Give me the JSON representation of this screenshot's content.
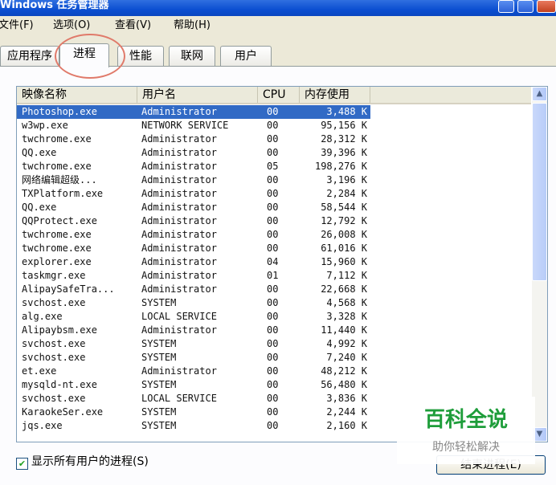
{
  "window": {
    "title": "Windows 任务管理器"
  },
  "menu": [
    "文件(F)",
    "选项(O)",
    "查看(V)",
    "帮助(H)"
  ],
  "tabs": [
    "应用程序",
    "进程",
    "性能",
    "联网",
    "用户"
  ],
  "active_tab": "进程",
  "columns": [
    "映像名称",
    "用户名",
    "CPU",
    "内存使用"
  ],
  "processes": [
    {
      "name": "Photoshop.exe",
      "user": "Administrator",
      "cpu": "00",
      "mem": "3,488 K"
    },
    {
      "name": "w3wp.exe",
      "user": "NETWORK SERVICE",
      "cpu": "00",
      "mem": "95,156 K"
    },
    {
      "name": "twchrome.exe",
      "user": "Administrator",
      "cpu": "00",
      "mem": "28,312 K"
    },
    {
      "name": "QQ.exe",
      "user": "Administrator",
      "cpu": "00",
      "mem": "39,396 K"
    },
    {
      "name": "twchrome.exe",
      "user": "Administrator",
      "cpu": "05",
      "mem": "198,276 K"
    },
    {
      "name": "网络编辑超级...",
      "user": "Administrator",
      "cpu": "00",
      "mem": "3,196 K"
    },
    {
      "name": "TXPlatform.exe",
      "user": "Administrator",
      "cpu": "00",
      "mem": "2,284 K"
    },
    {
      "name": "QQ.exe",
      "user": "Administrator",
      "cpu": "00",
      "mem": "58,544 K"
    },
    {
      "name": "QQProtect.exe",
      "user": "Administrator",
      "cpu": "00",
      "mem": "12,792 K"
    },
    {
      "name": "twchrome.exe",
      "user": "Administrator",
      "cpu": "00",
      "mem": "26,008 K"
    },
    {
      "name": "twchrome.exe",
      "user": "Administrator",
      "cpu": "00",
      "mem": "61,016 K"
    },
    {
      "name": "explorer.exe",
      "user": "Administrator",
      "cpu": "04",
      "mem": "15,960 K"
    },
    {
      "name": "taskmgr.exe",
      "user": "Administrator",
      "cpu": "01",
      "mem": "7,112 K"
    },
    {
      "name": "AlipaySafeTra...",
      "user": "Administrator",
      "cpu": "00",
      "mem": "22,668 K"
    },
    {
      "name": "svchost.exe",
      "user": "SYSTEM",
      "cpu": "00",
      "mem": "4,568 K"
    },
    {
      "name": "alg.exe",
      "user": "LOCAL SERVICE",
      "cpu": "00",
      "mem": "3,328 K"
    },
    {
      "name": "Alipaybsm.exe",
      "user": "Administrator",
      "cpu": "00",
      "mem": "11,440 K"
    },
    {
      "name": "svchost.exe",
      "user": "SYSTEM",
      "cpu": "00",
      "mem": "4,992 K"
    },
    {
      "name": "svchost.exe",
      "user": "SYSTEM",
      "cpu": "00",
      "mem": "7,240 K"
    },
    {
      "name": "et.exe",
      "user": "Administrator",
      "cpu": "00",
      "mem": "48,212 K"
    },
    {
      "name": "mysqld-nt.exe",
      "user": "SYSTEM",
      "cpu": "00",
      "mem": "56,480 K"
    },
    {
      "name": "svchost.exe",
      "user": "LOCAL SERVICE",
      "cpu": "00",
      "mem": "3,836 K"
    },
    {
      "name": "KaraokeSer.exe",
      "user": "SYSTEM",
      "cpu": "00",
      "mem": "2,244 K"
    },
    {
      "name": "jqs.exe",
      "user": "SYSTEM",
      "cpu": "00",
      "mem": "2,160 K"
    }
  ],
  "selected_row": 0,
  "show_all_users": {
    "label": "显示所有用户的进程(S)",
    "checked": true
  },
  "end_process_label": "结束进程(E)",
  "watermark": {
    "title": "百科全说",
    "subtitle": "助你轻松解决"
  }
}
